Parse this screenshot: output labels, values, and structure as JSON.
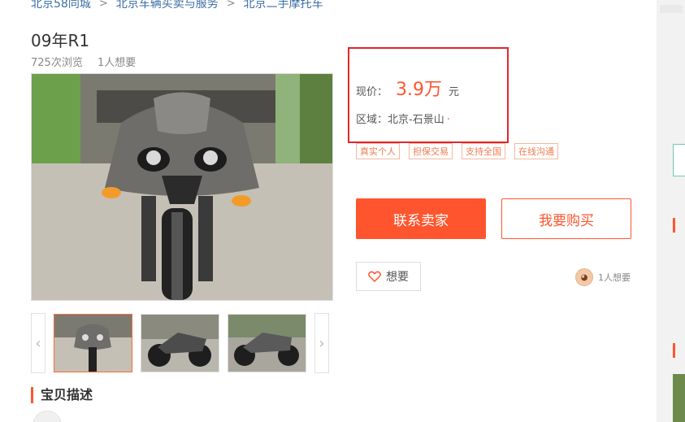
{
  "breadcrumb": {
    "items": [
      "北京58同城",
      "北京车辆买卖与服务",
      "北京二手摩托车"
    ],
    "separator": ">"
  },
  "listing": {
    "title": "09年R1",
    "views": "725次浏览",
    "wants": "1人想要"
  },
  "price": {
    "label": "现价：",
    "value": "3.9万",
    "unit": "元"
  },
  "region": {
    "label": "区域：",
    "value": "北京-石景山",
    "dot": "·"
  },
  "tags": [
    "真实个人",
    "担保交易",
    "支持全国",
    "在线沟通"
  ],
  "actions": {
    "contact": "联系卖家",
    "buy": "我要购买",
    "want": "想要",
    "want_count": "1人想要"
  },
  "section": {
    "description_title": "宝贝描述"
  },
  "icons": {
    "heart": "heart-icon",
    "prev": "chevron-left-icon",
    "next": "chevron-right-icon"
  },
  "colors": {
    "accent": "#ff552e",
    "highlight_border": "#e0262d",
    "link": "#3a6ea5"
  }
}
